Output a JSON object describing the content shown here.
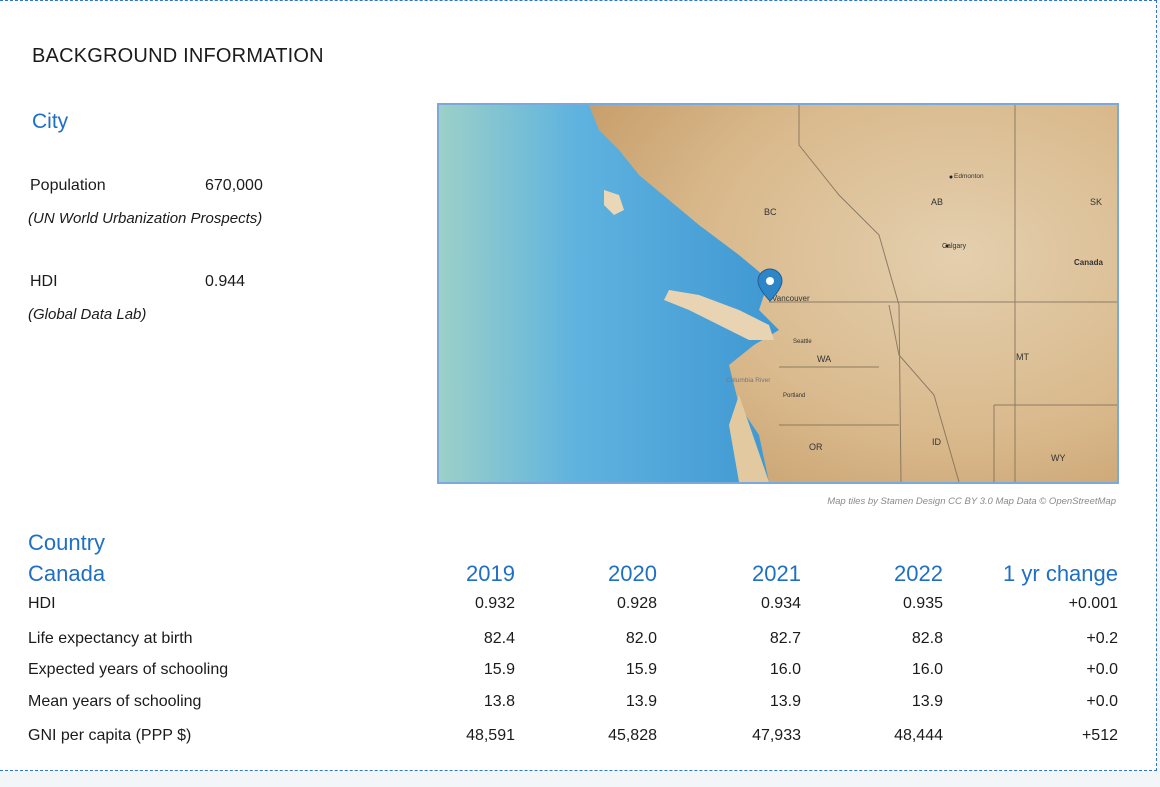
{
  "header": {
    "title": "BACKGROUND INFORMATION"
  },
  "city": {
    "heading": "City",
    "population_label": "Population",
    "population_value": "670,000",
    "population_source": "(UN World Urbanization Prospects)",
    "hdi_label": "HDI",
    "hdi_value": "0.944",
    "hdi_source": "(Global Data Lab)"
  },
  "map": {
    "credit": "Map tiles by Stamen Design CC BY 3.0 Map Data © OpenStreetMap",
    "labels": {
      "bc": "BC",
      "ab": "AB",
      "sk": "SK",
      "canada": "Canada",
      "edmonton": "Edmonton",
      "calgary": "Calgary",
      "vancouver": "Vancouver",
      "seattle": "Seattle",
      "wa": "WA",
      "mt": "MT",
      "columbia": "Columbia River",
      "portland": "Portland",
      "or": "OR",
      "id": "ID",
      "wy": "WY"
    },
    "marker_icon": "location-pin-icon",
    "colors": {
      "ocean": "#4fa8d8",
      "land": "#d9b98c",
      "marker": "#2f86c7"
    }
  },
  "country": {
    "heading": "Country",
    "name": "Canada",
    "columns": [
      "2019",
      "2020",
      "2021",
      "2022",
      "1 yr change"
    ],
    "rows": [
      {
        "label": "HDI",
        "values": [
          "0.932",
          "0.928",
          "0.934",
          "0.935",
          "+0.001"
        ]
      },
      {
        "label": "Life expectancy at birth",
        "values": [
          "82.4",
          "82.0",
          "82.7",
          "82.8",
          "+0.2"
        ]
      },
      {
        "label": "Expected years of schooling",
        "values": [
          "15.9",
          "15.9",
          "16.0",
          "16.0",
          "+0.0"
        ]
      },
      {
        "label": "Mean years of schooling",
        "values": [
          "13.8",
          "13.9",
          "13.9",
          "13.9",
          "+0.0"
        ]
      },
      {
        "label": "GNI per capita (PPP $)",
        "values": [
          "48,591",
          "45,828",
          "47,933",
          "48,444",
          "+512"
        ]
      }
    ]
  },
  "colors": {
    "accent": "#1f6fc4",
    "border": "#2f76c9"
  }
}
